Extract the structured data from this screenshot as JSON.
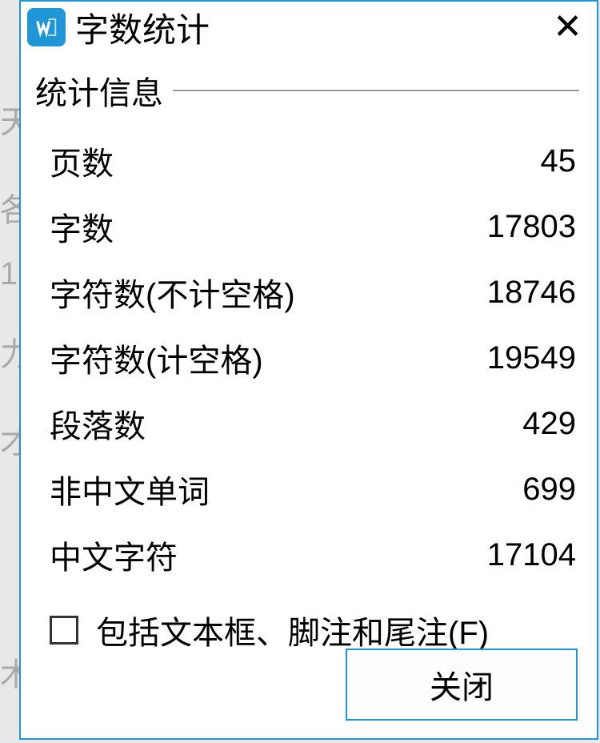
{
  "dialog": {
    "title": "字数统计",
    "section_title": "统计信息",
    "stats": [
      {
        "label": "页数",
        "value": "45"
      },
      {
        "label": "字数",
        "value": "17803"
      },
      {
        "label": "字符数(不计空格)",
        "value": "18746"
      },
      {
        "label": "字符数(计空格)",
        "value": "19549"
      },
      {
        "label": "段落数",
        "value": "429"
      },
      {
        "label": "非中文单词",
        "value": "699"
      },
      {
        "label": "中文字符",
        "value": "17104"
      }
    ],
    "checkbox_label": "包括文本框、脚注和尾注(F)",
    "close_button": "关闭"
  }
}
